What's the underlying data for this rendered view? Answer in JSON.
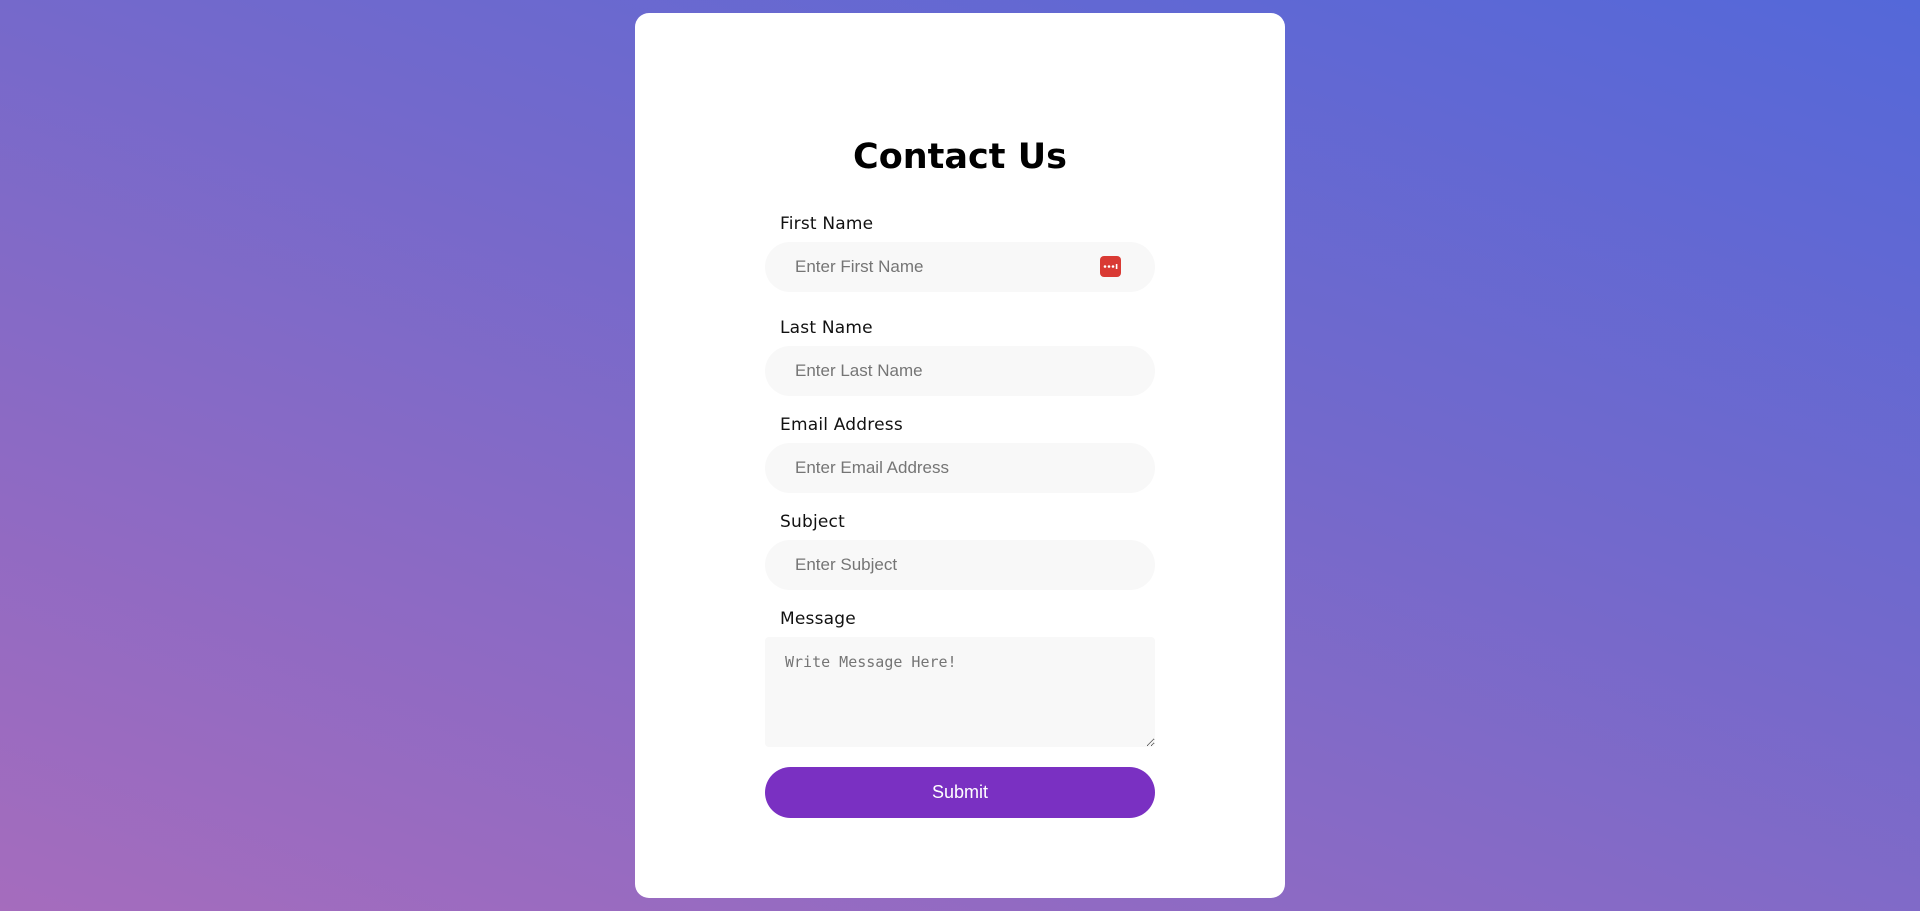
{
  "form": {
    "title": "Contact Us",
    "fields": [
      {
        "label": "First Name",
        "placeholder": "Enter First Name",
        "value": ""
      },
      {
        "label": "Last Name",
        "placeholder": "Enter Last Name",
        "value": ""
      },
      {
        "label": "Email Address",
        "placeholder": "Enter Email Address",
        "value": ""
      },
      {
        "label": "Subject",
        "placeholder": "Enter Subject",
        "value": ""
      }
    ],
    "message": {
      "label": "Message",
      "placeholder": "Write Message Here!",
      "value": ""
    },
    "submit_label": "Submit",
    "password_manager_icon": "password-manager-icon"
  },
  "colors": {
    "accent": "#7a30c2",
    "card": "#ffffff",
    "input_bg": "#f8f8f8",
    "password_icon": "#d93a34"
  }
}
